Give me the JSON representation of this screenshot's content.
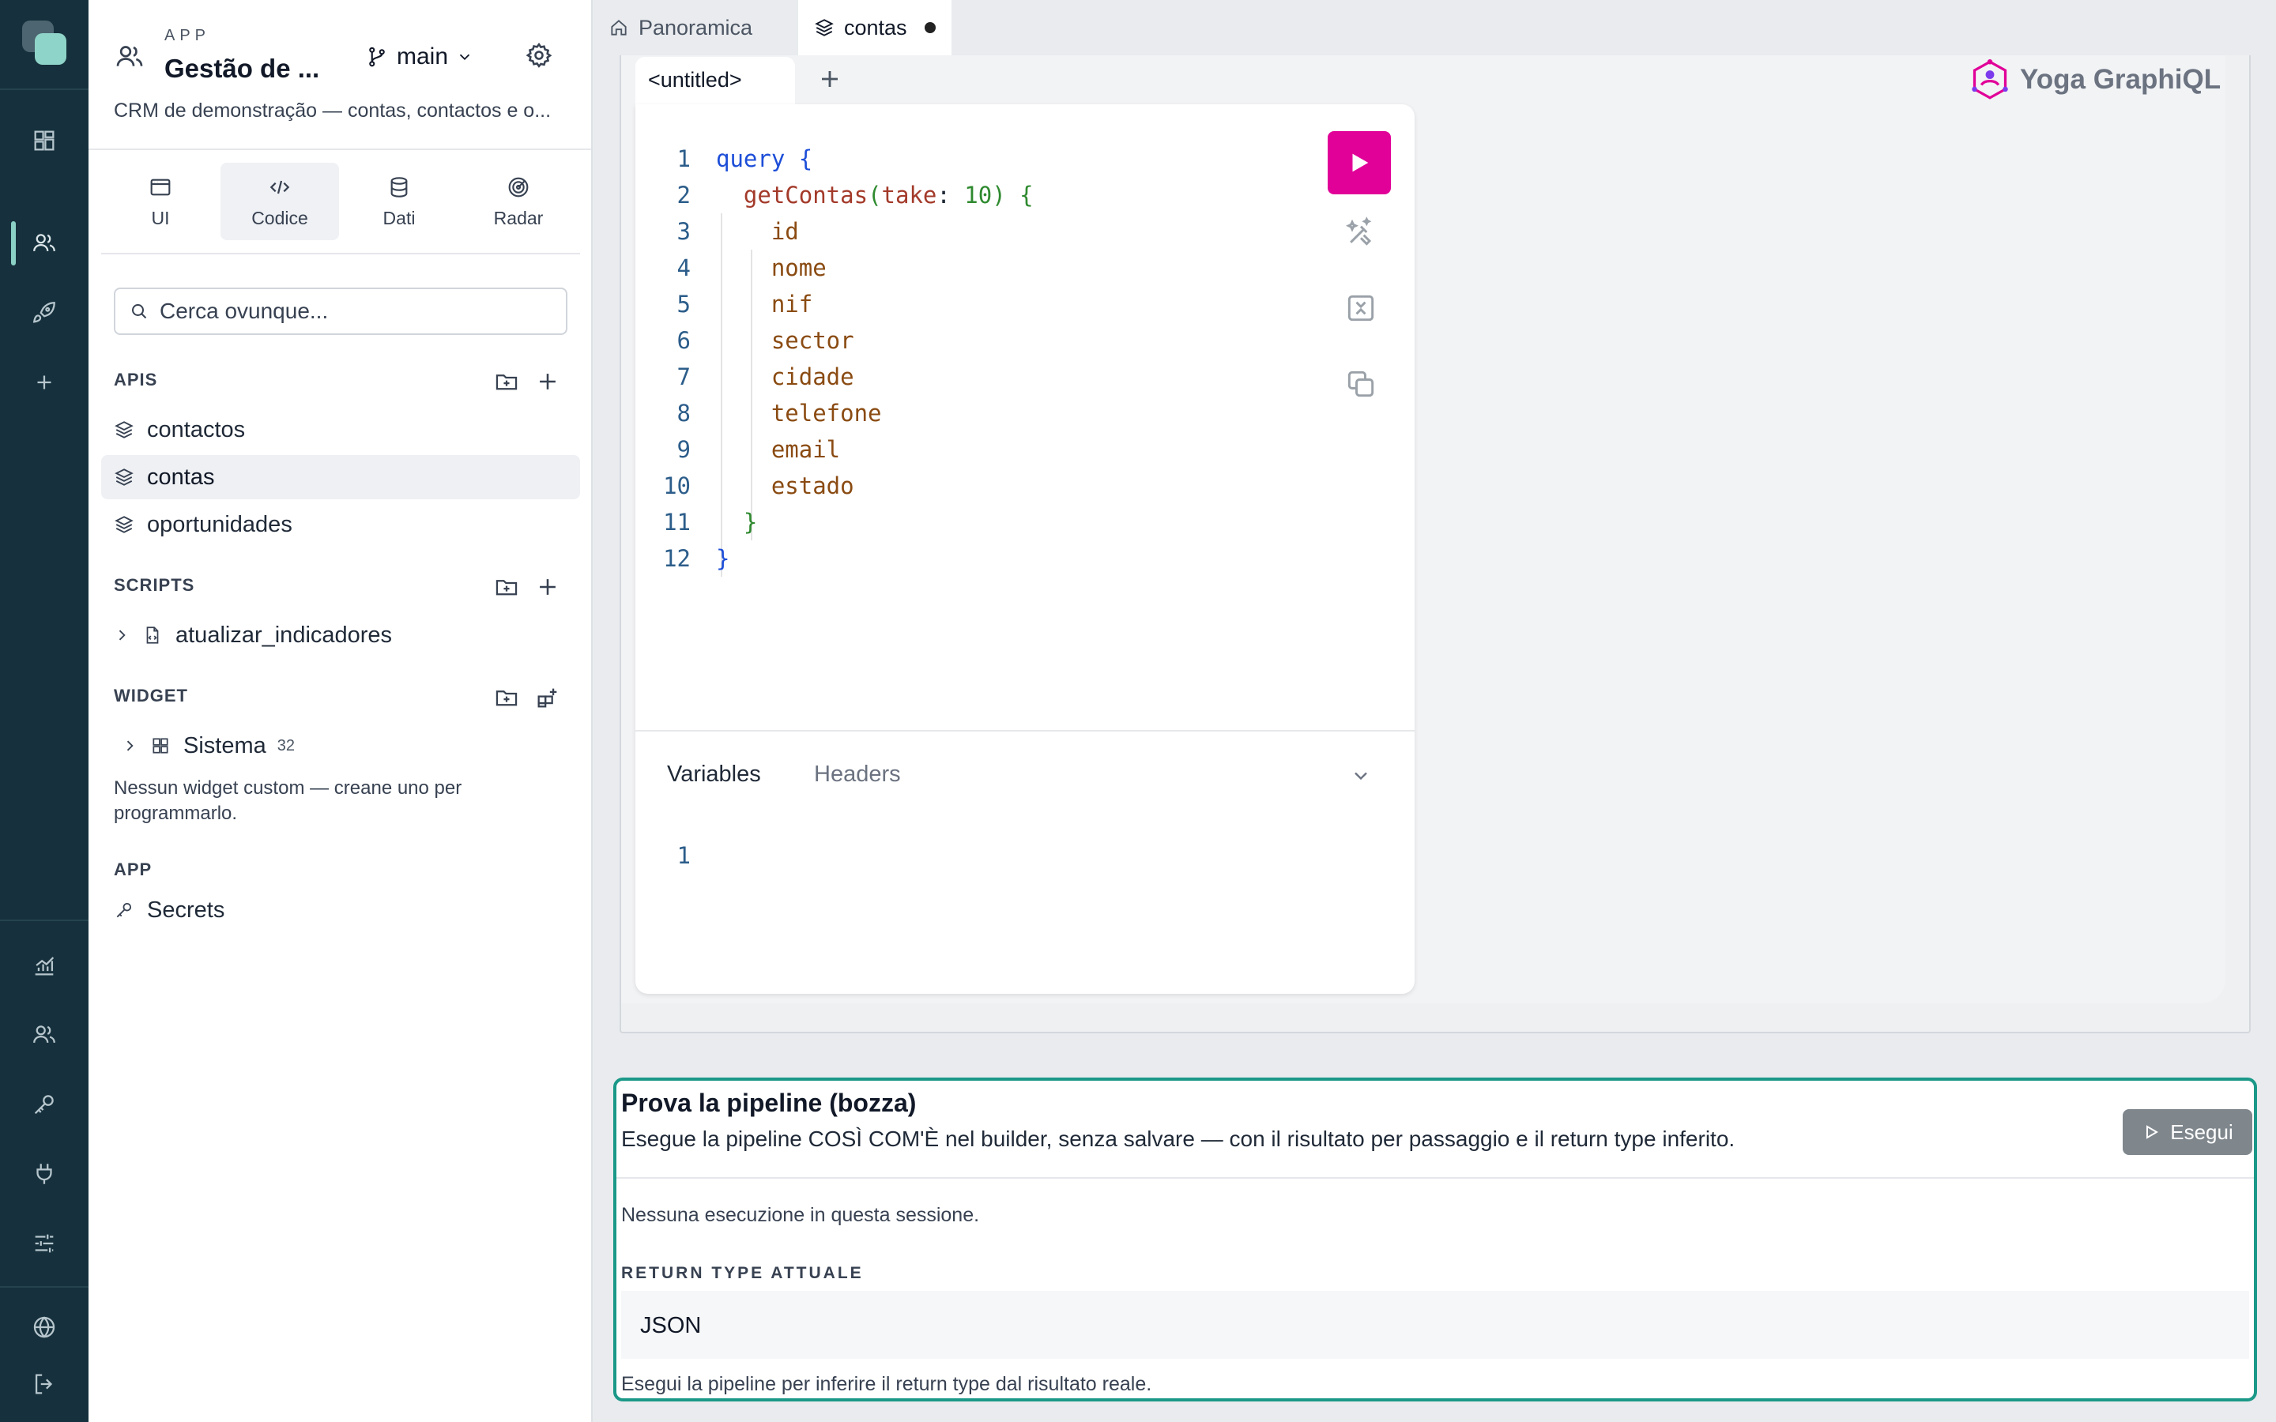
{
  "rail": {
    "icons": [
      "logo-icon",
      "dashboard-icon",
      "users-icon",
      "rocket-icon",
      "plus-icon",
      "analytics-icon",
      "team-icon",
      "key-icon",
      "plug-icon",
      "sliders-icon",
      "globe-icon",
      "logout-icon"
    ],
    "active": "users-icon"
  },
  "app": {
    "kicker": "APP",
    "title": "Gestão de ...",
    "branch": "main",
    "description": "CRM de demonstração — contas, contactos e o..."
  },
  "modes": [
    {
      "label": "UI",
      "icon": "window-icon"
    },
    {
      "label": "Codice",
      "icon": "code-icon",
      "active": true
    },
    {
      "label": "Dati",
      "icon": "database-icon"
    },
    {
      "label": "Radar",
      "icon": "radar-icon"
    }
  ],
  "search": {
    "placeholder": "Cerca ovunque..."
  },
  "sections": {
    "apis": {
      "title": "APIS",
      "items": [
        "contactos",
        "contas",
        "oportunidades"
      ],
      "active": "contas"
    },
    "scripts": {
      "title": "SCRIPTS",
      "items": [
        "atualizar_indicadores"
      ]
    },
    "widget": {
      "title": "WIDGET",
      "item": "Sistema",
      "count": "32",
      "empty": "Nessun widget custom — creane uno per programmarlo."
    },
    "app": {
      "title": "APP",
      "item": "Secrets"
    }
  },
  "tabs": [
    {
      "label": "Panoramica",
      "icon": "home-icon"
    },
    {
      "label": "contas",
      "icon": "layers-icon",
      "unsaved": true,
      "active": true
    }
  ],
  "graphiql": {
    "editor_tab": "<untitled>",
    "brand": "Yoga GraphiQL",
    "code_lines": [
      "query {",
      "  getContas(take: 10) {",
      "    id",
      "    nome",
      "    nif",
      "    sector",
      "    cidade",
      "    telefone",
      "    email",
      "    estado",
      "  }",
      "}"
    ],
    "line_numbers": [
      "1",
      "2",
      "3",
      "4",
      "5",
      "6",
      "7",
      "8",
      "9",
      "10",
      "11",
      "12"
    ],
    "variables_tab": "Variables",
    "headers_tab": "Headers",
    "variables_line": "1",
    "accent": "#e10098"
  },
  "pipeline": {
    "title": "Prova la pipeline (bozza)",
    "subtitle": "Esegue la pipeline COSÌ COM'È nel builder, senza salvare — con il risultato per passaggio e il return type inferito.",
    "run_label": "Esegui",
    "empty": "Nessuna esecuzione in questa sessione.",
    "return_label": "RETURN TYPE ATTUALE",
    "return_type": "JSON",
    "hint": "Esegui la pipeline per inferire il return type dal risultato reale.",
    "border_color": "#1b9888"
  }
}
